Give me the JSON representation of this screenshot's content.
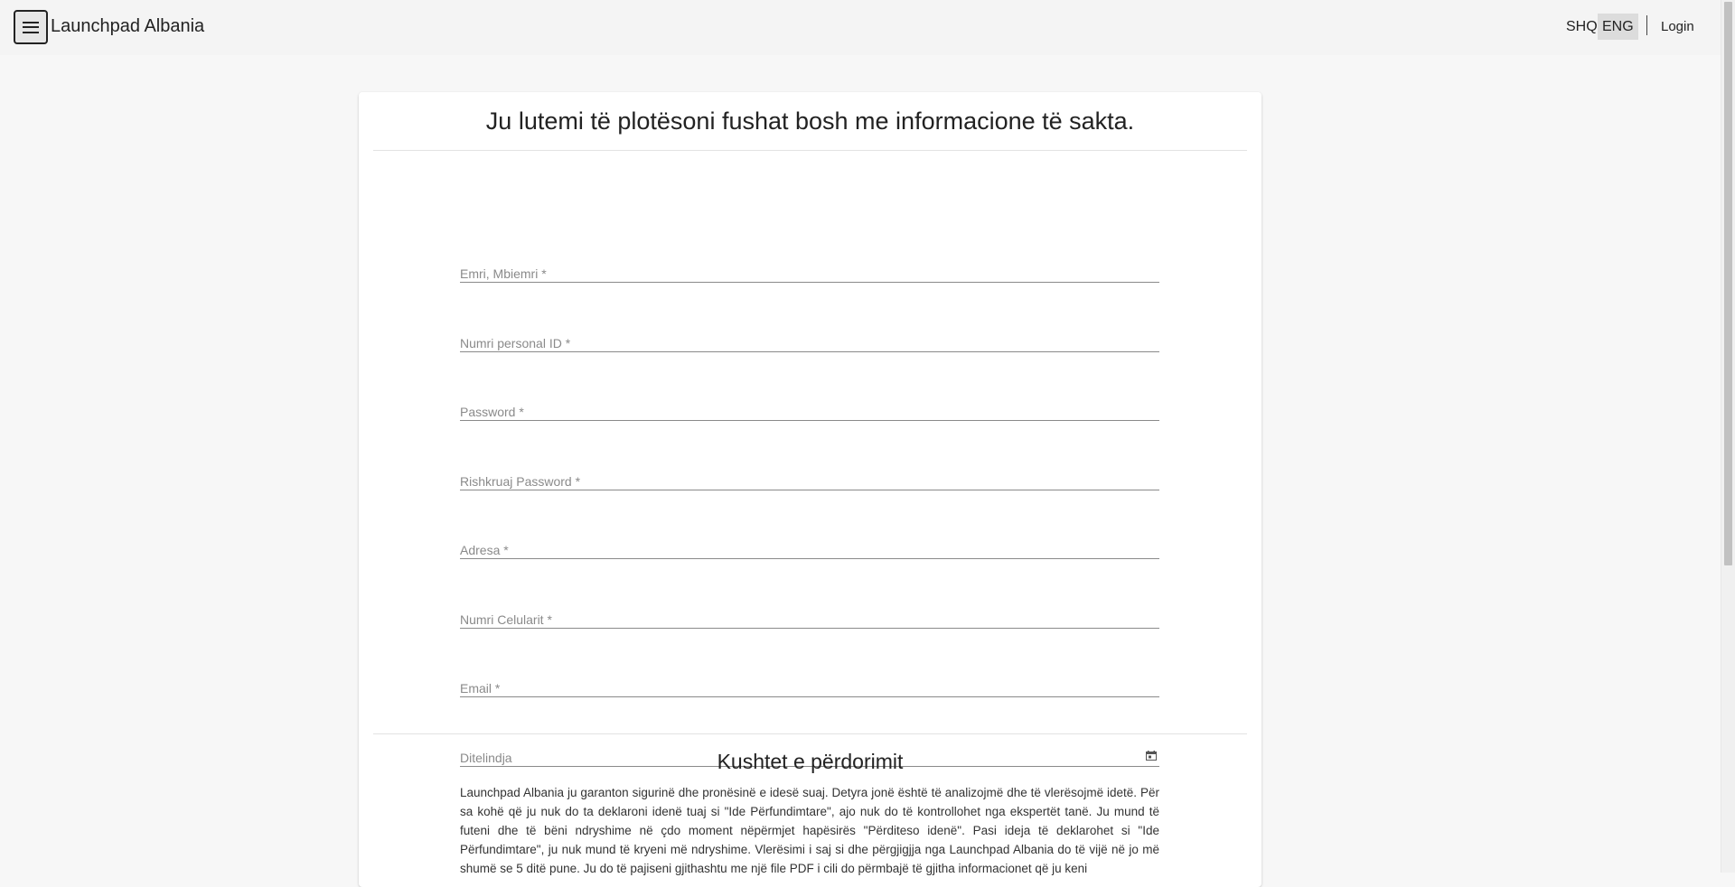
{
  "header": {
    "brand": "Launchpad Albania",
    "languages": [
      "SHQ",
      "ENG"
    ],
    "active_language": "ENG",
    "login_label": "Login"
  },
  "form": {
    "title": "Ju lutemi të plotësoni fushat bosh me informacione të sakta.",
    "fields": [
      {
        "placeholder": "Emri, Mbiemri *",
        "value": ""
      },
      {
        "placeholder": "Numri personal ID *",
        "value": ""
      },
      {
        "placeholder": "Password *",
        "value": ""
      },
      {
        "placeholder": "Rishkruaj Password *",
        "value": ""
      },
      {
        "placeholder": "Adresa *",
        "value": ""
      },
      {
        "placeholder": "Numri Celularit *",
        "value": ""
      },
      {
        "placeholder": "Email *",
        "value": ""
      },
      {
        "placeholder": "Ditelindja",
        "value": ""
      }
    ]
  },
  "terms": {
    "title": "Kushtet e përdorimit",
    "text": "Launchpad Albania ju garanton sigurinë dhe pronësinë e idesë suaj. Detyra jonë është të analizojmë dhe të vlerësojmë idetë. Për sa kohë që ju nuk do ta deklaroni idenë tuaj si \"Ide Përfundimtare\", ajo nuk do të kontrollohet nga ekspertët tanë. Ju mund të futeni dhe të bëni ndryshime në çdo moment nëpërmjet hapësirës \"Përditeso idenë\". Pasi ideja të deklarohet si \"Ide Përfundimtare\", ju nuk mund të kryeni më ndryshime. Vlerësimi i saj si dhe përgjigjja nga Launchpad Albania do të vijë në jo më shumë se 5 ditë pune. Ju do të pajiseni gjithashtu me një file PDF i cili do përmbajë të gjitha informacionet që ju keni"
  },
  "colors": {
    "page_bg": "#f7f7f7",
    "appbar_bg": "#f4f4f4",
    "active_lang_bg": "#dcdcdc"
  }
}
